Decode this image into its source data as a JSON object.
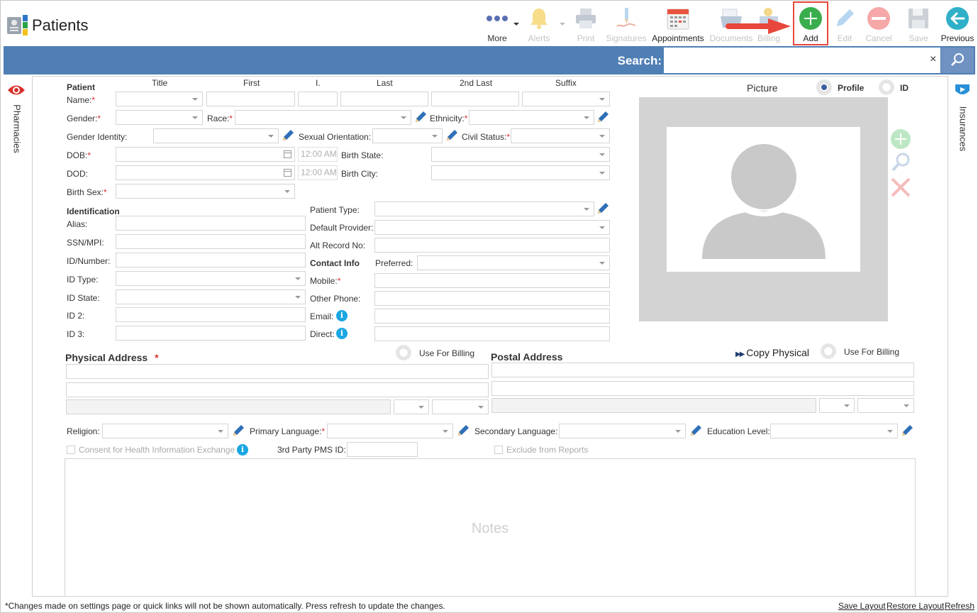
{
  "app": {
    "title": "Patients"
  },
  "toolbar": {
    "more": "More",
    "alerts": "Alerts",
    "print": "Print",
    "signatures": "Signatures",
    "appointments": "Appointments",
    "documents": "Documents",
    "billing": "Billing",
    "add": "Add",
    "edit": "Edit",
    "cancel": "Cancel",
    "save": "Save",
    "previous": "Previous"
  },
  "search": {
    "label": "Search:",
    "clear": "×",
    "value": ""
  },
  "side": {
    "left": "Pharmacies",
    "right": "Insurances"
  },
  "name_headers": {
    "title": "Title",
    "first": "First",
    "initial": "I.",
    "last": "Last",
    "second_last": "2nd Last",
    "suffix": "Suffix"
  },
  "patient": {
    "section": "Patient",
    "name": "Name:",
    "gender": "Gender:",
    "race": "Race:",
    "ethnicity": "Ethnicity:",
    "gender_identity": "Gender Identity:",
    "sexual_orientation": "Sexual Orientation:",
    "civil_status": "Civil Status:",
    "dob": "DOB:",
    "dod": "DOD:",
    "birth_state": "Birth State:",
    "birth_city": "Birth City:",
    "birth_sex": "Birth Sex:",
    "time_dob": "12:00 AM",
    "time_dod": "12:00 AM",
    "req": "*"
  },
  "identification": {
    "section": "Identification",
    "alias": "Alias:",
    "ssn": "SSN/MPI:",
    "id_number": "ID/Number:",
    "id_type": "ID Type:",
    "id_state": "ID State:",
    "id2": "ID 2:",
    "id3": "ID 3:"
  },
  "other": {
    "patient_type": "Patient Type:",
    "default_provider": "Default Provider:",
    "alt_record": "Alt Record No:"
  },
  "contact": {
    "section": "Contact Info",
    "preferred": "Preferred:",
    "mobile": "Mobile:",
    "other_phone": "Other Phone:",
    "email": "Email:",
    "direct": "Direct:"
  },
  "picture": {
    "title": "Picture",
    "profile": "Profile",
    "id": "ID"
  },
  "address": {
    "physical": "Physical Address",
    "postal": "Postal Address",
    "use_billing": "Use For Billing",
    "copy_physical": "Copy Physical"
  },
  "extra": {
    "religion": "Religion:",
    "primary_language": "Primary Language:",
    "secondary_language": "Secondary Language:",
    "education": "Education Level:",
    "consent": "Consent for Health Information Exchange",
    "third_party": "3rd Party PMS ID:",
    "exclude": "Exclude from Reports",
    "notes_placeholder": "Notes"
  },
  "footer": {
    "note": "*Changes made on settings page or quick links will not be shown automatically. Press refresh to update the changes.",
    "save_layout": "Save Layout",
    "restore_layout": "Restore Layout",
    "refresh": "Refresh"
  },
  "colors": {
    "search_bar": "#4f7fb4",
    "accent_red": "#e8473c",
    "add_green": "#3aae4c"
  }
}
